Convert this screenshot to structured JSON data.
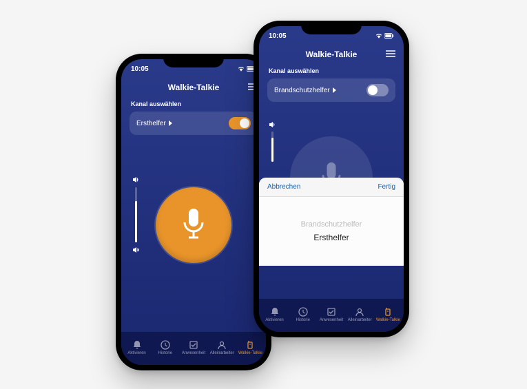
{
  "status": {
    "time": "10:05",
    "signal_icon": "signal",
    "wifi_icon": "wifi",
    "battery_icon": "battery"
  },
  "header": {
    "title": "Walkie-Talkie",
    "menu_icon": "menu"
  },
  "channel": {
    "label": "Kanal auswählen"
  },
  "leftPhone": {
    "selectedChannel": "Ersthelfer",
    "toggleOn": true
  },
  "rightPhone": {
    "selectedChannel": "Brandschutzhelfer",
    "toggleOn": false
  },
  "picker": {
    "cancel": "Abbrechen",
    "done": "Fertig",
    "options": [
      "Brandschutzhelfer",
      "Ersthelfer"
    ],
    "selected": "Ersthelfer"
  },
  "tabs": [
    {
      "label": "Aktivieren",
      "icon": "bell"
    },
    {
      "label": "Historie",
      "icon": "clock"
    },
    {
      "label": "Anwesenheit",
      "icon": "check-square"
    },
    {
      "label": "Alleinarbeiter",
      "icon": "user"
    },
    {
      "label": "Walkie-Talkie",
      "icon": "walkie"
    }
  ],
  "colors": {
    "accent": "#e8942a",
    "bgTop": "#2a3a8a",
    "bgBottom": "#1a2770",
    "tabBg": "#0f1850",
    "link": "#0a66c2"
  }
}
